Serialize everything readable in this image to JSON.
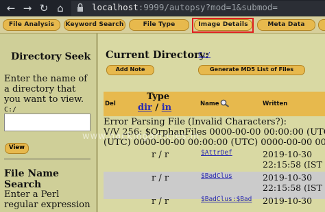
{
  "browser": {
    "back": "←",
    "forward": "→",
    "reload": "↻",
    "home": "⌂",
    "url_host": "localhost",
    "url_rest": ":9999/autopsy?mod=1&submod="
  },
  "tabs": [
    {
      "label": "File Analysis"
    },
    {
      "label": "Keyword Search"
    },
    {
      "label": "File Type"
    },
    {
      "label": "Image Details"
    },
    {
      "label": "Meta Data"
    }
  ],
  "left": {
    "seek_title": "Directory Seek",
    "seek_desc_1": "Enter the name of",
    "seek_desc_2": "a directory that",
    "seek_desc_3": "you want to view.",
    "seek_prefix": "C:/",
    "view_button": "View",
    "search_title": "File Name Search",
    "search_desc_1": "Enter a Perl",
    "search_desc_2": "regular expression"
  },
  "main": {
    "current_dir_label": "Current Directory:",
    "current_dir_value": "C:/",
    "add_note": "Add Note",
    "md5_button": "Generate MD5 List of Files",
    "columns": {
      "del": "Del",
      "type": "Type",
      "dir": "dir",
      "slash": "/",
      "in": "in",
      "name": "Name",
      "written": "Written"
    },
    "error_lines": [
      "Error Parsing File (Invalid Characters?):",
      "V/V 256: $OrphanFiles 0000-00-00 00:00:00 (UTC",
      "(UTC) 0000-00-00 00:00:00 (UTC) 0000-00-00 00"
    ],
    "rows": [
      {
        "type": "r / r",
        "name": "$AttrDef",
        "date": "2019-10-30",
        "time": "22:15:58 (IST"
      },
      {
        "type": "r / r",
        "name": "$BadClus",
        "date": "2019-10-30",
        "time": "22:15:58 (IST"
      },
      {
        "type": "r / r",
        "name": "$BadClus:$Bad",
        "date": "2019-10-30",
        "time": ""
      }
    ]
  },
  "watermark": "www.hackingarticles.in"
}
